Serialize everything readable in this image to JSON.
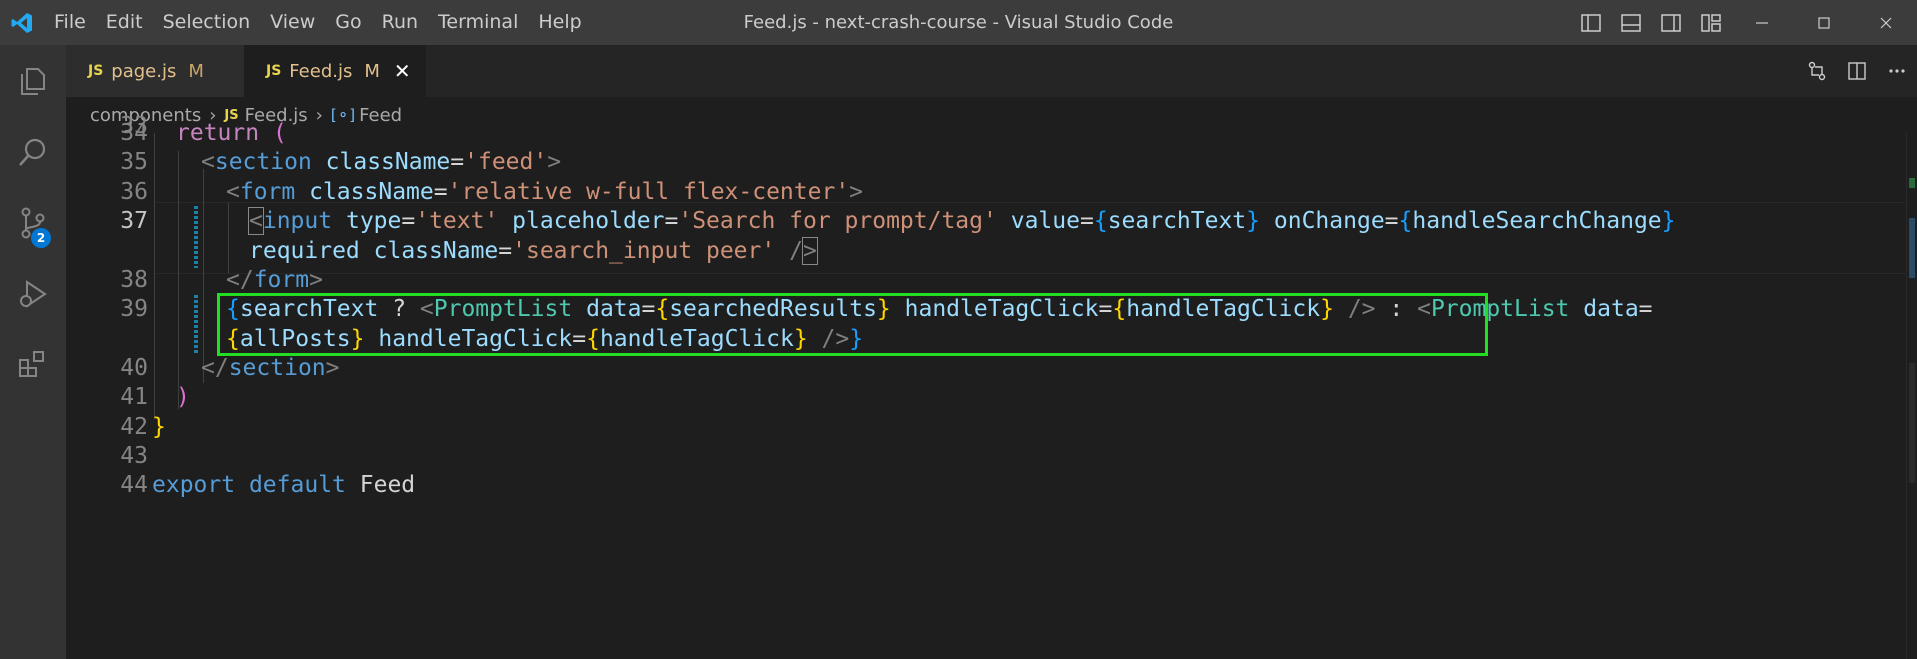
{
  "window": {
    "title": "Feed.js - next-crash-course - Visual Studio Code"
  },
  "menu": [
    "File",
    "Edit",
    "Selection",
    "View",
    "Go",
    "Run",
    "Terminal",
    "Help"
  ],
  "activity_bar": {
    "items": [
      "explorer-icon",
      "search-icon",
      "source-control-icon",
      "run-debug-icon",
      "extensions-icon"
    ],
    "source_control_badge": "2"
  },
  "tabs": [
    {
      "icon": "JS",
      "name": "page.js",
      "status": "M",
      "active": false
    },
    {
      "icon": "JS",
      "name": "Feed.js",
      "status": "M",
      "active": true,
      "close": "✕"
    }
  ],
  "breadcrumb": {
    "folder": "components",
    "file_icon": "JS",
    "file": "Feed.js",
    "symbol_icon": "[⚬]",
    "symbol": "Feed"
  },
  "editor": {
    "partial_top_line": "33",
    "lines": [
      {
        "num": "34",
        "text_a": "return",
        "text_b": " (",
        "indent": "  "
      },
      {
        "num": "35"
      },
      {
        "num": "36"
      },
      {
        "num": "37"
      },
      {
        "num": ""
      },
      {
        "num": "38"
      },
      {
        "num": "39"
      },
      {
        "num": ""
      },
      {
        "num": "40"
      },
      {
        "num": "41"
      },
      {
        "num": "42"
      },
      {
        "num": "43"
      },
      {
        "num": "44"
      }
    ],
    "code": {
      "l34_return": "return",
      "l34_paren": "(",
      "l35_section": "section",
      "l35_attr": "className",
      "l35_val": "'feed'",
      "l36_form": "form",
      "l36_attr": "className",
      "l36_val": "'relative w-full flex-center'",
      "l37_input": "input",
      "l37_type": "type",
      "l37_type_val": "'text'",
      "l37_ph": "placeholder",
      "l37_ph_val": "'Search for prompt/tag'",
      "l37_value": "value",
      "l37_value_var": "searchText",
      "l37_onchange": "onChange",
      "l37_onchange_var": "handleSearchChange",
      "l37b_required": "required",
      "l37b_class": "className",
      "l37b_class_val": "'search_input peer'",
      "l38_form": "form",
      "l39_var": "searchText",
      "l39_q": " ? ",
      "l39_cmp1": "PromptList",
      "l39_data": "data",
      "l39_data_var": "searchedResults",
      "l39_htc": "handleTagClick",
      "l39_htc_var": "handleTagClick",
      "l39_colon": " : ",
      "l39_cmp2": "PromptList",
      "l39_data2": "data",
      "l39b_var": "allPosts",
      "l39b_htc": "handleTagClick",
      "l39b_htc_var": "handleTagClick",
      "l40_section": "section",
      "l44_export": "export",
      "l44_default": "default",
      "l44_name": "Feed"
    }
  },
  "colors": {
    "highlight_box": "#22dd22",
    "accent": "#0078d4"
  }
}
